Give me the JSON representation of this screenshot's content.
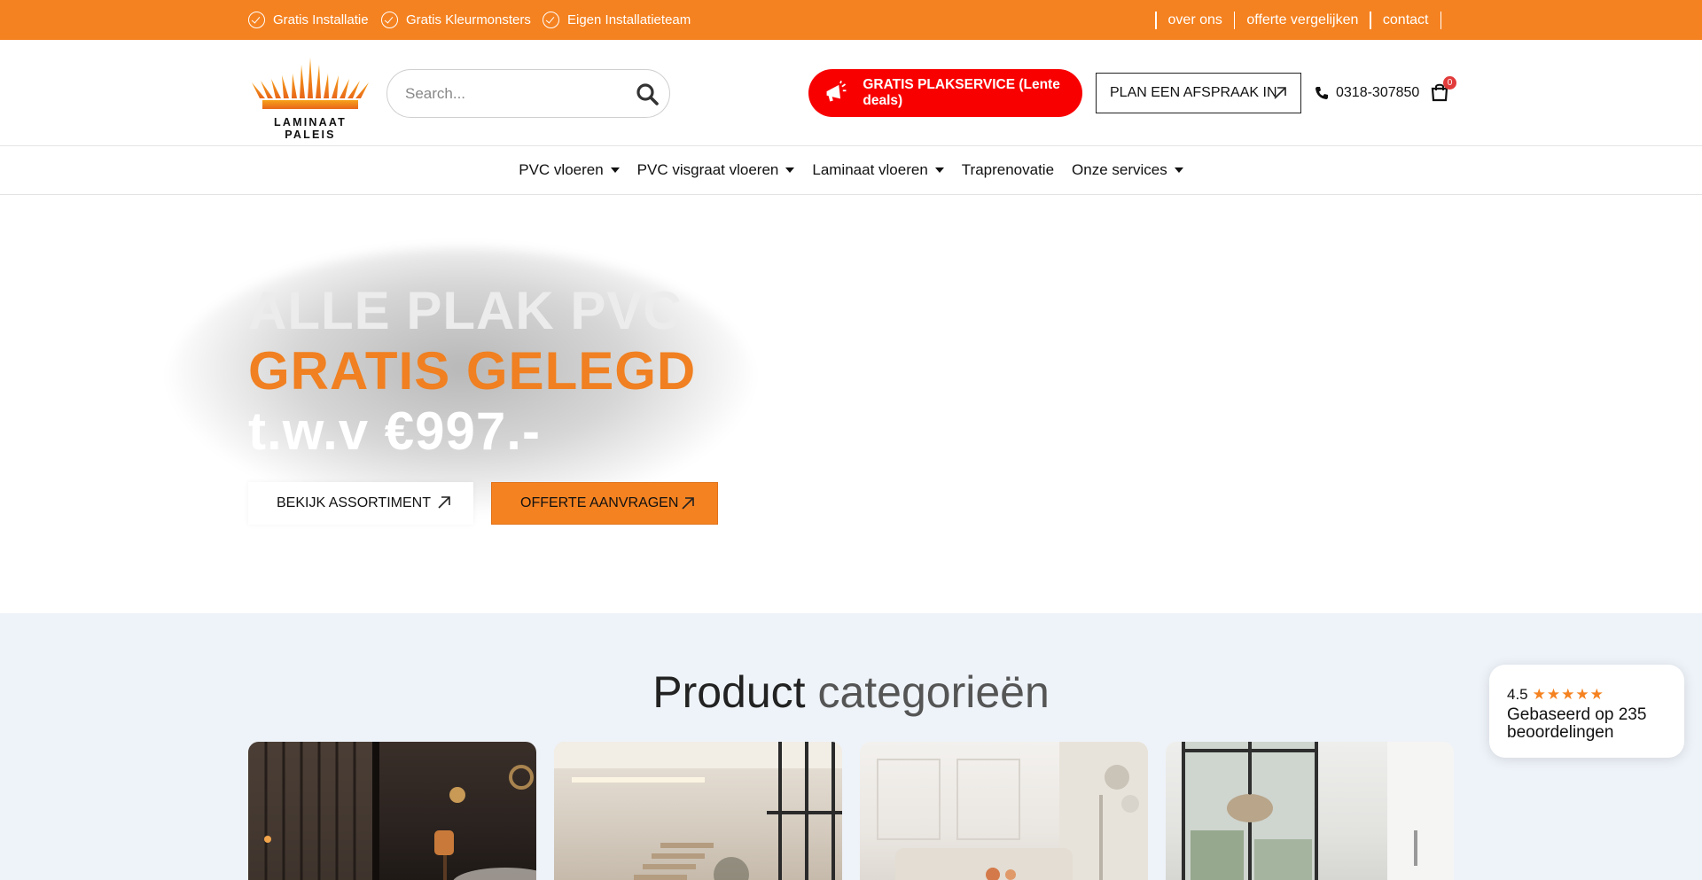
{
  "topbar": {
    "usps": [
      "Gratis Installatie",
      "Gratis Kleurmonsters",
      "Eigen Installatieteam"
    ],
    "links": [
      "over ons",
      "offerte vergelijken",
      "contact"
    ]
  },
  "header": {
    "logo_text": "LAMINAAT PALEIS",
    "search_placeholder": "Search...",
    "promo_label": "GRATIS PLAKSERVICE (Lente deals)",
    "appointment_label": "PLAN EEN AFSPRAAK IN",
    "phone": "0318-307850",
    "cart_count": "0"
  },
  "nav": {
    "items": [
      "PVC vloeren",
      "PVC visgraat vloeren",
      "Laminaat vloeren",
      "Traprenovatie",
      "Onze services"
    ]
  },
  "hero": {
    "line1": "ALLE PLAK PVC",
    "line2": "GRATIS GELEGD",
    "line3": "t.w.v €997.-",
    "button_secondary": "BEKIJK ASSORTIMENT",
    "button_primary": "OFFERTE AANVRAGEN"
  },
  "categories": {
    "title_main": "Product",
    "title_soft": "categorieën"
  },
  "review": {
    "score": "4.5",
    "stars": "★★★★★",
    "text": "Gebaseerd op 235 beoordelingen"
  },
  "colors": {
    "accent": "#f58220",
    "promo_red": "#f80000",
    "section_bg": "#eef3f9"
  }
}
